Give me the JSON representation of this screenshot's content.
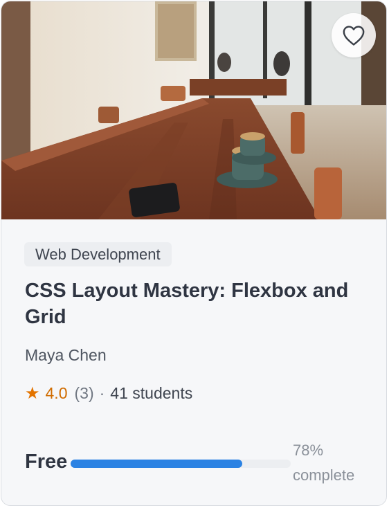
{
  "course": {
    "category": "Web Development",
    "title": "CSS Layout Mastery: Flexbox and Grid",
    "instructor": "Maya Chen",
    "rating": "4.0",
    "rating_count": "(3)",
    "separator": "·",
    "students": "41 students",
    "price": "Free",
    "progress_fraction": 0.78,
    "progress_label": "78% complete"
  },
  "thumbnail": {
    "subject": "coffee-shop-table-with-espresso-cups"
  },
  "icons": {
    "favorite": "heart-outline-icon",
    "rating": "star-icon"
  },
  "colors": {
    "accent": "#2b82e3",
    "rating": "#e37400",
    "title": "#2f3542",
    "card_background": "#f6f7f9"
  }
}
